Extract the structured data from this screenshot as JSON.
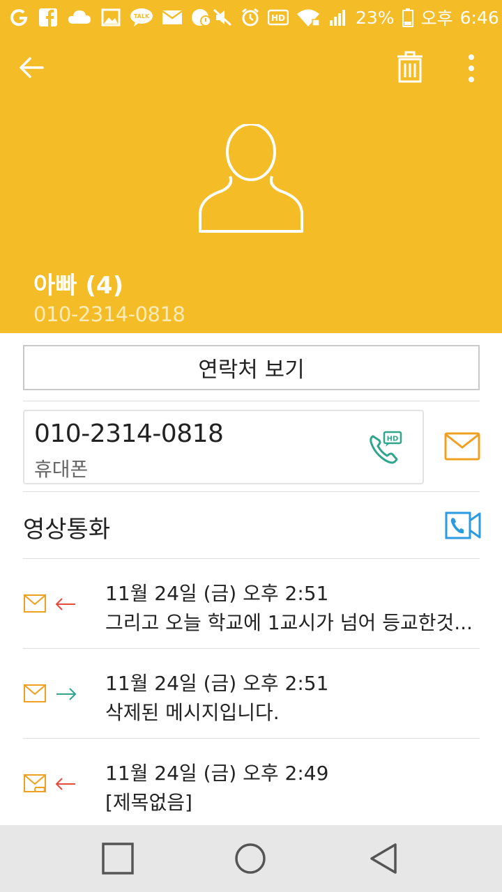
{
  "status_bar": {
    "battery": "23%",
    "ampm": "오후",
    "time": "6:46",
    "icons": [
      "app-o-icon",
      "facebook-icon",
      "cloud-icon",
      "gallery-icon",
      "kakaotalk-icon",
      "mail-icon",
      "alarm-app-icon",
      "mute-icon",
      "alarm-icon",
      "hd-voice-icon",
      "wifi-icon",
      "signal-icon",
      "battery-icon"
    ],
    "hd_badge": "HD",
    "talk_badge": "TALK"
  },
  "header": {
    "name": "아빠 (4)",
    "number": "010-2314-0818",
    "bg_color": "#f4bd27"
  },
  "view_contact_label": "연락처 보기",
  "phone": {
    "number": "010-2314-0818",
    "type": "휴대폰",
    "hd_badge": "HD"
  },
  "video_call_label": "영상통화",
  "messages": [
    {
      "date": "11월 24일 (금) 오후 2:51",
      "text": "그리고 오늘 학교에 1교시가 넘어 등교한것...",
      "direction": "incoming"
    },
    {
      "date": "11월 24일 (금) 오후 2:51",
      "text": "삭제된 메시지입니다.",
      "direction": "outgoing"
    },
    {
      "date": "11월 24일 (금) 오후 2:49",
      "text": "[제목없음]",
      "direction": "incoming"
    }
  ],
  "colors": {
    "accent": "#f4bd27",
    "message_icon": "#f0a020",
    "incoming_arrow": "#e84a3a",
    "outgoing_arrow": "#2fa58c",
    "hd_call": "#2fa58c",
    "video_call": "#2a9be0"
  }
}
